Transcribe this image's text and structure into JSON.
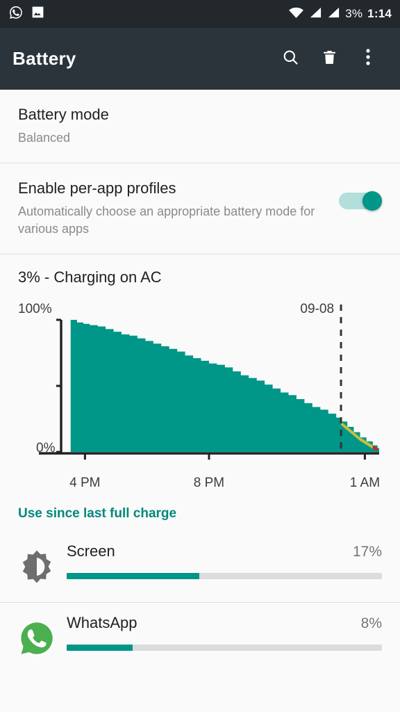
{
  "statusbar": {
    "left_icons": [
      "whatsapp-icon",
      "image-icon"
    ],
    "right_icons": [
      "wifi-icon",
      "signal-sim1-icon",
      "signal-sim2-icon"
    ],
    "battery_percent": "3%",
    "time": "1:14"
  },
  "toolbar": {
    "title": "Battery",
    "actions": [
      {
        "name": "search-icon",
        "label": "Search"
      },
      {
        "name": "trash-icon",
        "label": "Delete"
      },
      {
        "name": "overflow-menu-icon",
        "label": "More options"
      }
    ]
  },
  "settings": {
    "battery_mode": {
      "title": "Battery mode",
      "value": "Balanced"
    },
    "per_app_profiles": {
      "title": "Enable per-app profiles",
      "summary": "Automatically choose an appropriate battery mode for various apps",
      "toggle_state": "on"
    }
  },
  "chart_data": {
    "type": "area",
    "title": "3% - Charging on AC",
    "xlabel": "",
    "ylabel": "",
    "ylim": [
      0,
      100
    ],
    "grid": false,
    "legend": "none",
    "ytick_labels": [
      "100%",
      "0%"
    ],
    "yticks": [
      100,
      0
    ],
    "xtick_labels": [
      "4 PM",
      "8 PM",
      "1 AM"
    ],
    "xtick_positions_pct": [
      7.5,
      46.5,
      95.5
    ],
    "annotations": [
      {
        "text": "09-08",
        "type": "day-divider",
        "x_pct": 88.0
      }
    ],
    "series": [
      {
        "name": "Battery level",
        "color": "#009688",
        "x_pct": [
          3.0,
          5.0,
          7.0,
          9.0,
          11.5,
          14.0,
          16.5,
          19.0,
          21.5,
          24.0,
          26.5,
          29.0,
          31.5,
          34.0,
          36.5,
          39.0,
          41.5,
          44.0,
          46.5,
          49.0,
          51.5,
          54.0,
          56.5,
          59.0,
          61.5,
          64.0,
          66.5,
          69.0,
          71.5,
          74.0,
          76.5,
          79.0,
          81.5,
          84.0,
          86.5,
          88.0,
          90.0,
          92.0,
          94.0,
          96.0,
          98.0,
          99.5
        ],
        "values": [
          100,
          98,
          97,
          96,
          95,
          93,
          91,
          89,
          88,
          86,
          84,
          82,
          80,
          78,
          76,
          73,
          71,
          69,
          67,
          66,
          64,
          61,
          58,
          56,
          54,
          51,
          48,
          45,
          43,
          40,
          37,
          34,
          32,
          29,
          26,
          23,
          19,
          15,
          11,
          8,
          5,
          3
        ]
      }
    ],
    "warning_bands": [
      {
        "name": "low-battery-warn",
        "color": "#c6c13a",
        "from_pct": 88.0,
        "to_pct": 98.0
      },
      {
        "name": "critical-battery-warn",
        "color": "#c62828",
        "from_pct": 97.0,
        "to_pct": 100.0
      }
    ]
  },
  "usage": {
    "section_title": "Use since last full charge",
    "items": [
      {
        "icon": "brightness-icon",
        "name": "Screen",
        "percent_label": "17%",
        "bar_fill_pct": 42
      },
      {
        "icon": "whatsapp-icon",
        "name": "WhatsApp",
        "percent_label": "8%",
        "bar_fill_pct": 21
      }
    ]
  },
  "colors": {
    "accent": "#009688",
    "accent_dark": "#00897b",
    "toolbar": "#2b343a",
    "statusbar": "#22282c",
    "background": "#fafafa",
    "divider": "#e0e0e0",
    "bar_track": "#dcdcdc"
  }
}
